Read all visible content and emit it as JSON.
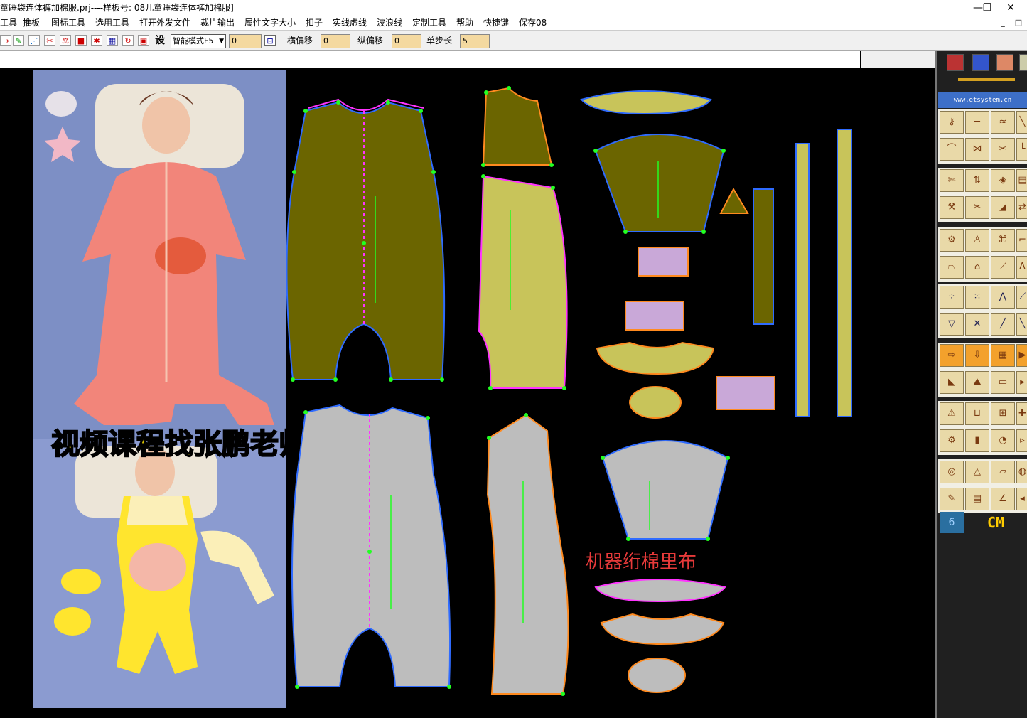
{
  "window": {
    "title": "童睡袋连体裤加棉服.prj----样板号: 08儿童睡袋连体裤加棉服]",
    "minimize": "—",
    "maximize": "❐",
    "close": "✕"
  },
  "menu": [
    "工具",
    "推板",
    "图标工具",
    "选用工具",
    "打开外发文件",
    "裁片输出",
    "属性文字大小",
    "扣子",
    "实线虚线",
    "波浪线",
    "定制工具",
    "帮助",
    "快捷键",
    "保存08"
  ],
  "mdi": {
    "min": "_",
    "restore": "□"
  },
  "toolbar": {
    "mode": "智能模式F5",
    "mode_value": "0",
    "h_offset_label": "横偏移",
    "h_offset": "0",
    "v_offset_label": "纵偏移",
    "v_offset": "0",
    "step_label": "单步长",
    "step": "5",
    "setting_label": "设"
  },
  "overlay": {
    "video_course": "视频课程找张鹏老师领取",
    "machine_lining": "机器绗棉里布"
  },
  "right_panel": {
    "logo_text": "www.etsystem.cn",
    "unit": "CM",
    "size_number": "6"
  },
  "colors": {
    "canvas": "#000000",
    "fabric_dark": "#6b6500",
    "fabric_light": "#c8c45a",
    "lining_gray": "#bdbdbd",
    "outline_blue": "#2f6bff",
    "outline_orange": "#ff8a1f",
    "outline_magenta": "#ff33ff",
    "point_green": "#22ff22"
  }
}
